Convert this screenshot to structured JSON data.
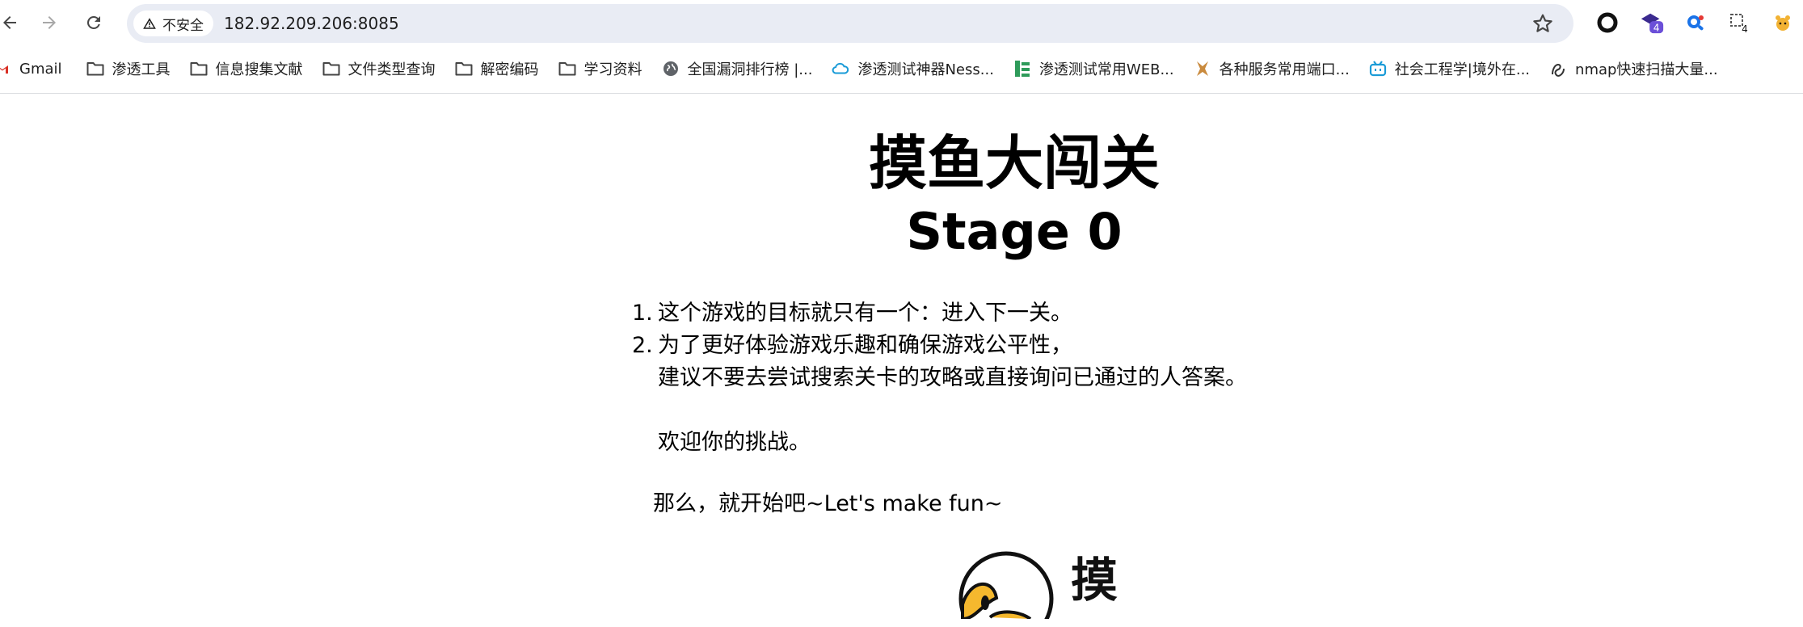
{
  "browser": {
    "security_label": "不安全",
    "url": "182.92.209.206:8085",
    "extension_badge": "4",
    "extension_badge_2": "4"
  },
  "bookmarks": [
    {
      "label": "Gmail",
      "icon": "gmail-icon"
    },
    {
      "label": "渗透工具",
      "icon": "folder-icon"
    },
    {
      "label": "信息搜集文献",
      "icon": "folder-icon"
    },
    {
      "label": "文件类型查询",
      "icon": "folder-icon"
    },
    {
      "label": "解密编码",
      "icon": "folder-icon"
    },
    {
      "label": "学习资料",
      "icon": "folder-icon"
    },
    {
      "label": "全国漏洞排行榜 |...",
      "icon": "globe-icon"
    },
    {
      "label": "渗透测试神器Ness...",
      "icon": "cloud-icon"
    },
    {
      "label": "渗透测试常用WEB...",
      "icon": "site-icon"
    },
    {
      "label": "各种服务常用端口...",
      "icon": "site-icon"
    },
    {
      "label": "社会工程学|境外在...",
      "icon": "bilibili-icon"
    },
    {
      "label": "nmap快速扫描大量...",
      "icon": "site-icon"
    }
  ],
  "page": {
    "title": "摸鱼大闯关",
    "stage": "Stage 0",
    "rule1_num": "1.",
    "rule1_text": "这个游戏的目标就只有一个：进入下一关。",
    "rule2_num": "2.",
    "rule2_text": "为了更好体验游戏乐趣和确保游戏公平性，",
    "rule2_cont": "建议不要去尝试搜索关卡的攻略或直接询问已通过的人答案。",
    "welcome": "欢迎你的挑战。",
    "cta": "那么，就开始吧~Let's make fun~",
    "mascot_char": "摸"
  },
  "colors": {
    "omnibox_bg": "#e9ecf4",
    "badge_purple": "#6b4fd8",
    "accent_blue": "#1a73e8"
  }
}
